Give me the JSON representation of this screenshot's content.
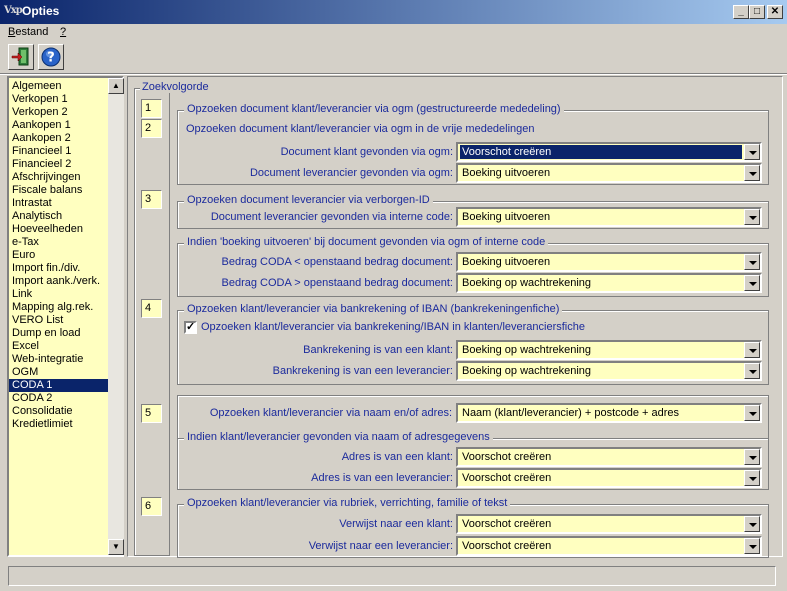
{
  "window": {
    "logo": "Vxp",
    "title": "Opties",
    "minimize": "_",
    "maximize": "□",
    "close": "✕"
  },
  "menu": {
    "items": [
      "Bestand",
      "?"
    ]
  },
  "toolbar": {
    "icons": [
      "exit-door-icon",
      "help-icon"
    ]
  },
  "nav": {
    "items": [
      "Algemeen",
      "Verkopen 1",
      "Verkopen 2",
      "Aankopen 1",
      "Aankopen 2",
      "Financieel 1",
      "Financieel 2",
      "Afschrijvingen",
      "Fiscale balans",
      "Intrastat",
      "Analytisch",
      "Hoeveelheden",
      "e-Tax",
      "Euro",
      "Import fin./div.",
      "Import aank./verk.",
      "Link",
      "Mapping alg.rek.",
      "VERO List",
      "Dump en load",
      "Excel",
      "Web-integratie",
      "OGM",
      "CODA 1",
      "CODA 2",
      "Consolidatie",
      "Kredietlimiet"
    ],
    "selected": "CODA 1",
    "scroll_up": "▲",
    "scroll_down": "▼"
  },
  "zoekvolgorde": {
    "label": "Zoekvolgorde",
    "numbers": [
      "1",
      "2",
      "3",
      "4",
      "5",
      "6"
    ]
  },
  "group1": {
    "title": "Opzoeken document klant/leverancier via ogm (gestructureerde mededeling)",
    "line2": "Opzoeken document klant/leverancier via ogm in de vrije mededelingen",
    "klant_label": "Document klant gevonden via ogm:",
    "klant_value": "Voorschot creëren",
    "lev_label": "Document leverancier gevonden via ogm:",
    "lev_value": "Boeking uitvoeren"
  },
  "group2": {
    "title": "Opzoeken document leverancier via verborgen-ID",
    "lev_label": "Document leverancier gevonden via interne code:",
    "lev_value": "Boeking uitvoeren"
  },
  "group3": {
    "title": "Indien 'boeking uitvoeren' bij document gevonden via ogm of interne code",
    "kleiner_label": "Bedrag CODA < openstaand bedrag document:",
    "kleiner_value": "Boeking uitvoeren",
    "groter_label": "Bedrag CODA > openstaand bedrag document:",
    "groter_value": "Boeking op wachtrekening"
  },
  "group4": {
    "title": "Opzoeken klant/leverancier via bankrekening of IBAN (bankrekeningenfiche)",
    "checkbox_label": "Opzoeken klant/leverancier via bankrekening/IBAN in klanten/leveranciersfiche",
    "checkbox_checked": "✓",
    "klant_label": "Bankrekening is van een klant:",
    "klant_value": "Boeking op wachtrekening",
    "lev_label": "Bankrekening is van een leverancier:",
    "lev_value": "Boeking op wachtrekening"
  },
  "group5": {
    "label": "Opzoeken klant/leverancier via naam en/of adres:",
    "value": "Naam (klant/leverancier) + postcode + adres",
    "sub_title": "Indien klant/leverancier gevonden via naam of adresgegevens",
    "klant_label": "Adres is van een klant:",
    "klant_value": "Voorschot creëren",
    "lev_label": "Adres is van een leverancier:",
    "lev_value": "Voorschot creëren"
  },
  "group6": {
    "title": "Opzoeken klant/leverancier via rubriek, verrichting, familie of tekst",
    "klant_label": "Verwijst naar een klant:",
    "klant_value": "Voorschot creëren",
    "lev_label": "Verwijst naar een leverancier:",
    "lev_value": "Voorschot creëren"
  },
  "colors": {
    "accent": "#0a246a",
    "field_bg": "#ffffc0",
    "label_blue": "#1b2a9c",
    "window_bg": "#d4d0c8"
  }
}
